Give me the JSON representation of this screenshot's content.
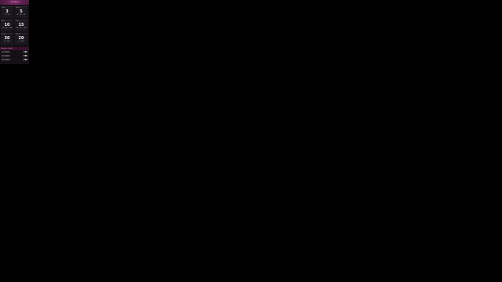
{
  "panel": {
    "title": "Countdown"
  },
  "tiles": [
    {
      "top": "Days",
      "value": "3",
      "sub": "2 - 12"
    },
    {
      "top": "Hours",
      "value": "5",
      "sub": "4 - 15 - 20"
    },
    {
      "top": "Mins",
      "value": "10",
      "sub": "10 - 40 - 100"
    },
    {
      "top": "Secs",
      "value": "15",
      "sub": "15 - 30 - 150"
    },
    {
      "top": "Level",
      "value": "30",
      "sub": "6 - 120"
    },
    {
      "top": "Rank",
      "value": "20",
      "sub": "6 - 100"
    }
  ],
  "list": {
    "title": "Lovense Levels",
    "rows": [
      {
        "label": "pumpkin",
        "qty": "18s"
      },
      {
        "label": "pumpkin",
        "qty": "18s"
      },
      {
        "label": "pumpkin",
        "qty": "18s"
      }
    ]
  }
}
